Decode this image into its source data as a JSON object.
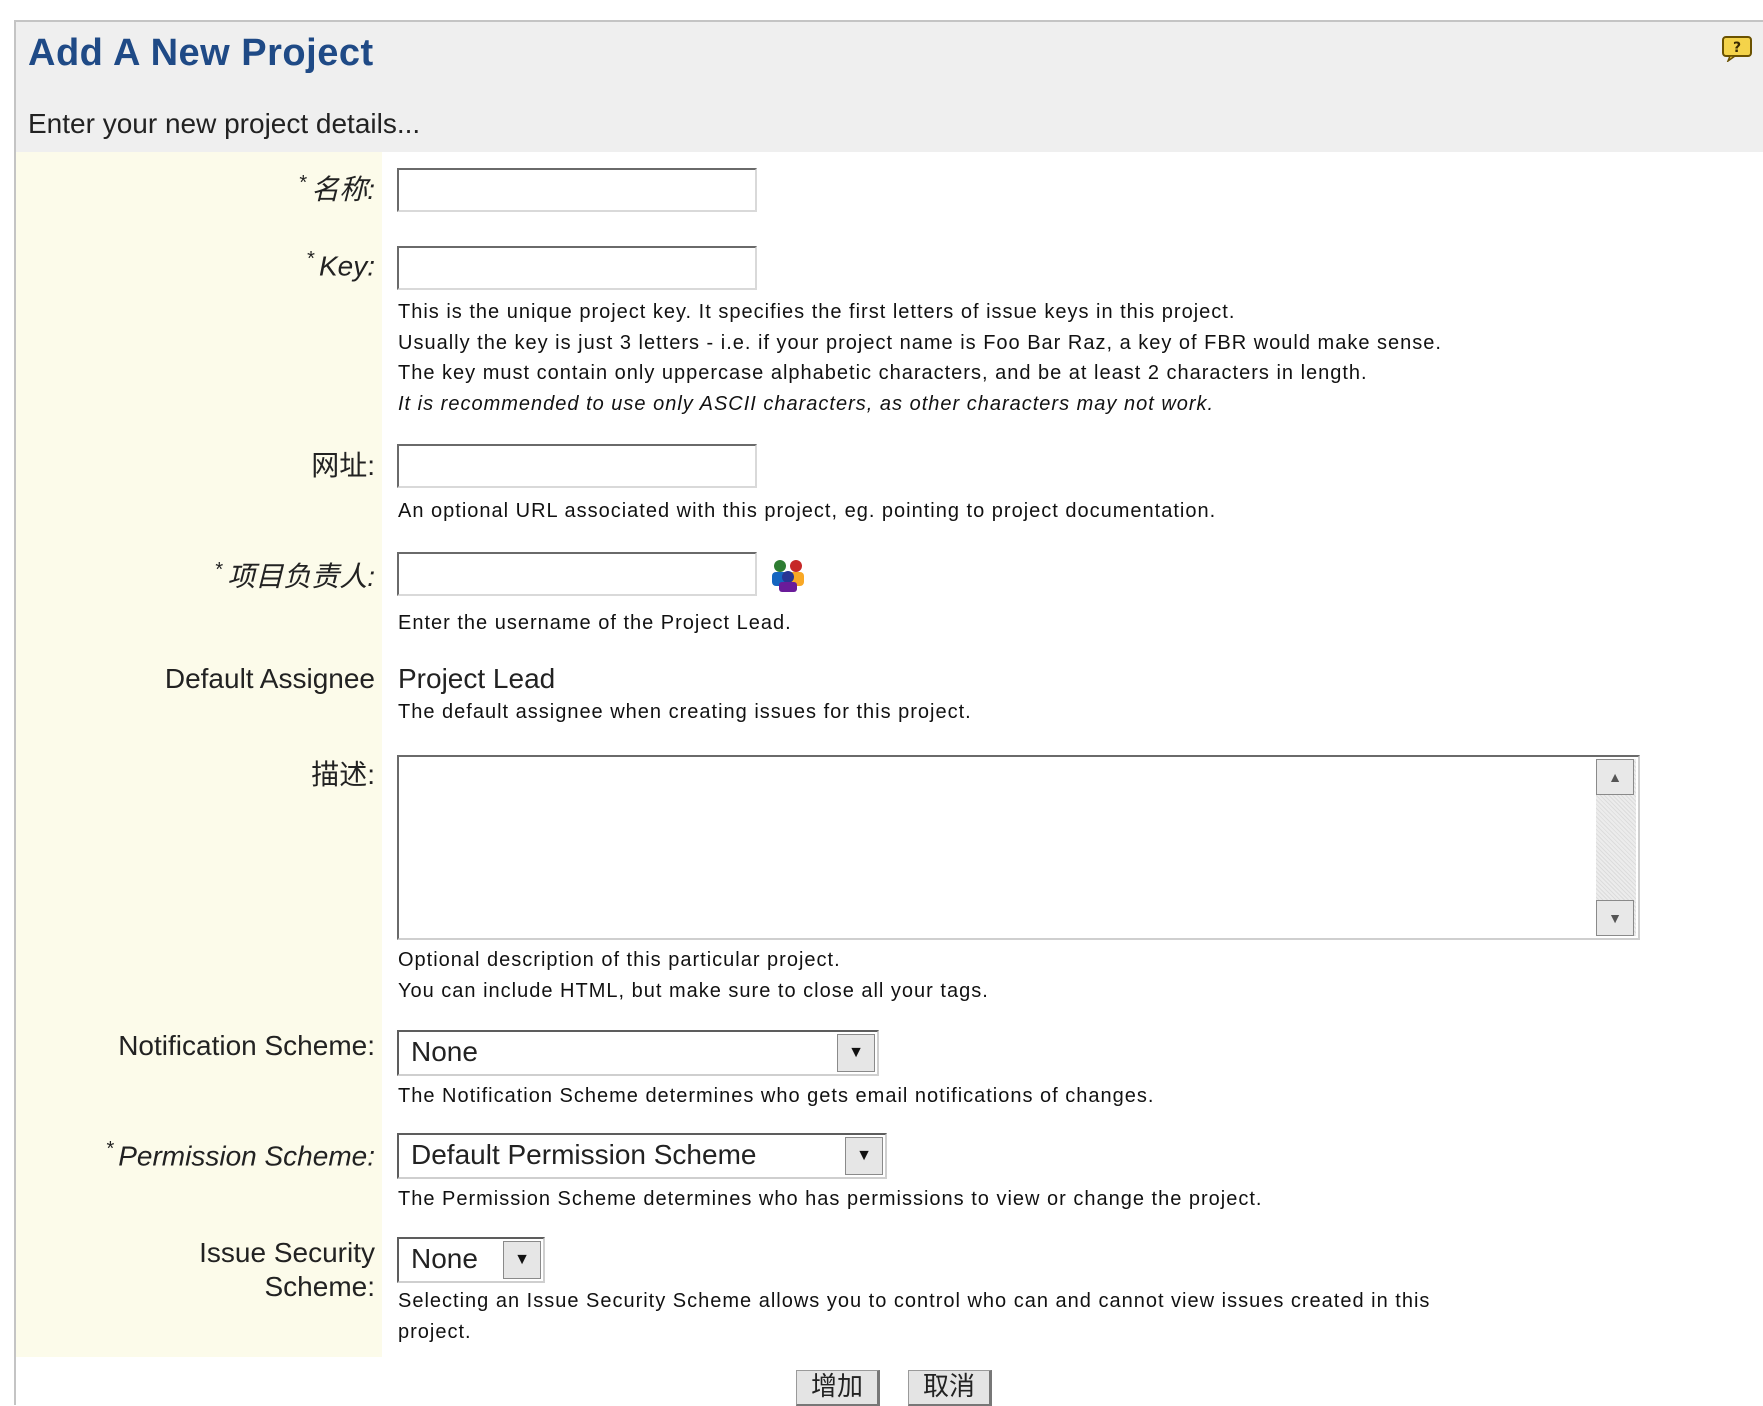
{
  "header": {
    "title": "Add A New Project",
    "subtitle": "Enter your new project details..."
  },
  "fields": {
    "name": {
      "label": "名称:",
      "value": ""
    },
    "key": {
      "label": "Key:",
      "value": "",
      "hint1": "This is the unique project key. It specifies the first letters of issue keys in this project.",
      "hint2": "Usually the key is just 3 letters - i.e. if your project name is Foo Bar Raz, a key of FBR would make sense.",
      "hint3": "The key must contain only uppercase alphabetic characters, and be at least 2 characters in length.",
      "hint4": "It is recommended to use only ASCII characters, as other characters may not work."
    },
    "url": {
      "label": "网址:",
      "value": "",
      "hint": "An optional URL associated with this project, eg. pointing to project documentation."
    },
    "lead": {
      "label": "项目负责人:",
      "value": "",
      "hint": "Enter the username of the Project Lead."
    },
    "assignee": {
      "label": "Default Assignee",
      "value": "Project Lead",
      "hint": "The default assignee when creating issues for this project."
    },
    "description": {
      "label": "描述:",
      "value": "",
      "hint1": "Optional description of this particular project.",
      "hint2": "You can include HTML, but make sure to close all your tags."
    },
    "notification": {
      "label": "Notification Scheme:",
      "selected": "None",
      "hint": "The Notification Scheme determines who gets email notifications of changes."
    },
    "permission": {
      "label": "Permission Scheme:",
      "selected": "Default Permission Scheme",
      "hint": "The Permission Scheme determines who has permissions to view or change the project."
    },
    "security": {
      "label1": "Issue Security",
      "label2": "Scheme:",
      "selected": "None",
      "hint1": "Selecting an Issue Security Scheme allows you to control who can and cannot view issues created in this",
      "hint2": "project."
    }
  },
  "required_mark": "*",
  "buttons": {
    "add": "增加",
    "cancel": "取消"
  },
  "icons": {
    "help": "help-icon",
    "user_picker": "user-picker-icon"
  }
}
